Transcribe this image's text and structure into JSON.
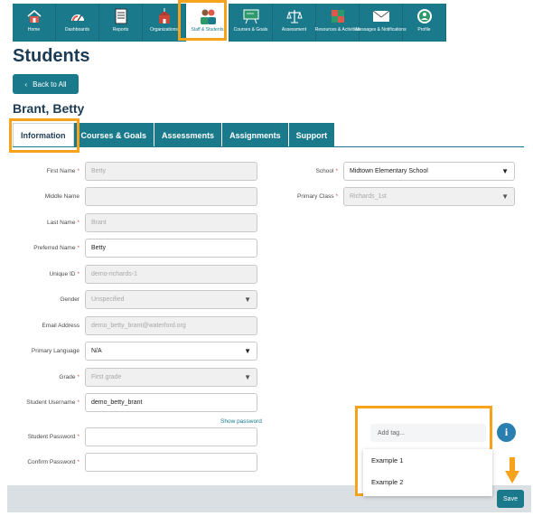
{
  "nav": {
    "items": [
      {
        "label": "Home",
        "icon": "house-icon"
      },
      {
        "label": "Dashboards",
        "icon": "gauge-icon"
      },
      {
        "label": "Reports",
        "icon": "report-icon"
      },
      {
        "label": "Organizations",
        "icon": "school-building-icon"
      },
      {
        "label": "Staff & Students",
        "icon": "people-icon"
      },
      {
        "label": "Courses & Goals",
        "icon": "chalkboard-icon"
      },
      {
        "label": "Assessment",
        "icon": "scales-icon"
      },
      {
        "label": "Resources & Activities",
        "icon": "puzzle-icon"
      },
      {
        "label": "Messages & Notifications",
        "icon": "envelope-icon"
      },
      {
        "label": "Profile",
        "icon": "profile-icon"
      }
    ],
    "active_index": 4
  },
  "page": {
    "title": "Students",
    "back_label": "Back to All",
    "student_name": "Brant, Betty"
  },
  "tabs": [
    "Information",
    "Courses & Goals",
    "Assessments",
    "Assignments",
    "Support"
  ],
  "form_left": {
    "first_name": {
      "label": "First Name",
      "value": "Betty"
    },
    "middle_name": {
      "label": "Middle Name",
      "value": ""
    },
    "last_name": {
      "label": "Last Name",
      "value": "Brant"
    },
    "preferred_name": {
      "label": "Preferred Name",
      "value": "Betty"
    },
    "unique_id": {
      "label": "Unique ID",
      "value": "demo-richards-1"
    },
    "gender": {
      "label": "Gender",
      "value": "Unspecified"
    },
    "email": {
      "label": "Email Address",
      "value": "demo_betty_brant@waterford.org"
    },
    "primary_language": {
      "label": "Primary Language",
      "value": "N/A"
    },
    "grade": {
      "label": "Grade",
      "value": "First grade"
    },
    "username": {
      "label": "Student Username",
      "value": "demo_betty_brant"
    },
    "show_password": "Show password",
    "password": {
      "label": "Student Password",
      "value": ""
    },
    "confirm_password": {
      "label": "Confirm Password",
      "value": ""
    }
  },
  "form_right": {
    "school": {
      "label": "School",
      "value": "Midtown Elementary School"
    },
    "primary_class": {
      "label": "Primary Class",
      "value": "Richards_1st"
    }
  },
  "tags": {
    "placeholder": "Add tag...",
    "options": [
      "Example 1",
      "Example 2"
    ]
  },
  "save_label": "Save",
  "colors": {
    "brand": "#1a7a8c",
    "highlight": "#f7a21b",
    "heading": "#1c3b55",
    "required": "#d9534f"
  }
}
